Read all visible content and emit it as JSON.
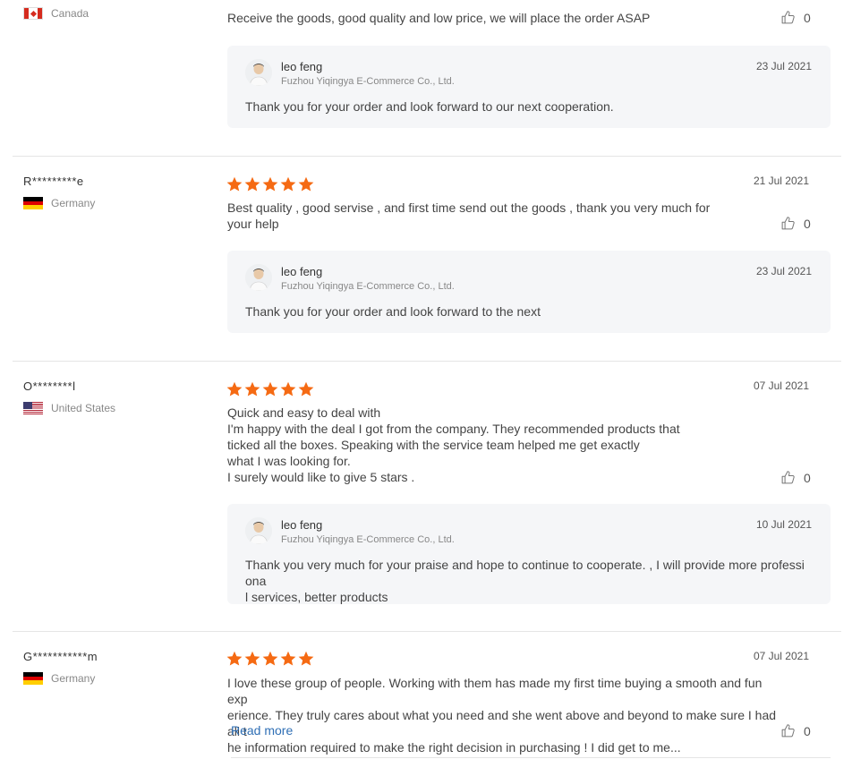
{
  "reviews": [
    {
      "user": "",
      "country": "Canada",
      "flag": "canada",
      "date": "",
      "text": "Receive the goods, good quality and low price, we will place the order ASAP",
      "likes": "0",
      "reply": {
        "name": "leo feng",
        "company": "Fuzhou Yiqingya E-Commerce Co., Ltd.",
        "date": "23 Jul 2021",
        "text": "Thank you for your order and look forward to our next cooperation."
      }
    },
    {
      "user": "R*********e",
      "country": "Germany",
      "flag": "germany",
      "rating": 5,
      "date": "21 Jul 2021",
      "text": "Best quality , good servise , and first time send out the goods , thank you very much for your help",
      "likes": "0",
      "reply": {
        "name": "leo feng",
        "company": "Fuzhou Yiqingya E-Commerce Co., Ltd.",
        "date": "23 Jul 2021",
        "text": "Thank you for your order and look forward to the next"
      }
    },
    {
      "user": "O********l",
      "country": "United States",
      "flag": "usa",
      "rating": 5,
      "date": "07 Jul 2021",
      "text_lines": [
        "Quick and easy to deal with",
        "I'm happy with the deal I got from the company. They recommended products that",
        "ticked all the boxes. Speaking with the service team helped me get exactly",
        "what I was looking for.",
        "I surely would like to give 5 stars ."
      ],
      "likes": "0",
      "reply": {
        "name": "leo feng",
        "company": "Fuzhou Yiqingya E-Commerce Co., Ltd.",
        "date": "10 Jul 2021",
        "text_lines": [
          "Thank you very much for your praise and hope to continue to cooperate. , I will provide more professiona",
          "l services, better products"
        ]
      }
    },
    {
      "user": "G***********m",
      "country": "Germany",
      "flag": "germany",
      "rating": 5,
      "date": "07 Jul 2021",
      "text_lines": [
        "I love these group of people. Working with them has made my first time buying a smooth and fun exp",
        "erience. They truly cares about what you need and she went above and beyond to make sure I had all t",
        "he information required to make the right decision in purchasing ! I did get to me..."
      ],
      "read_more": "Read more",
      "likes": "0"
    }
  ]
}
